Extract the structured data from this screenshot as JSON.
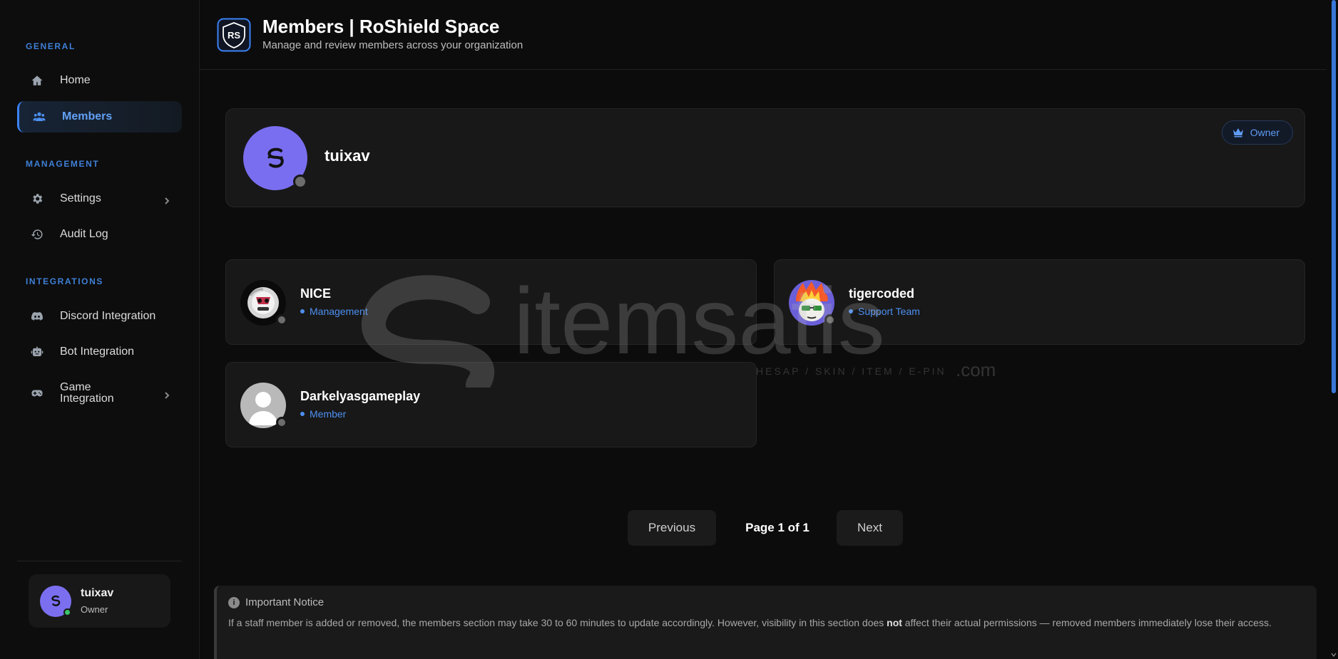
{
  "sidebar": {
    "sections": {
      "general": "GENERAL",
      "management": "MANAGEMENT",
      "integrations": "INTEGRATIONS"
    },
    "items": {
      "home": {
        "label": "Home",
        "icon": "home-icon"
      },
      "members": {
        "label": "Members",
        "icon": "users-icon",
        "active": true
      },
      "settings": {
        "label": "Settings",
        "icon": "gear-icon"
      },
      "audit_log": {
        "label": "Audit Log",
        "icon": "history-icon"
      },
      "discord": {
        "label": "Discord Integration",
        "icon": "discord-icon"
      },
      "bot": {
        "label": "Bot Integration",
        "icon": "robot-icon"
      },
      "game_line1": "Game",
      "game_line2": "Integration"
    },
    "user": {
      "name": "tuixav",
      "role": "Owner",
      "status": "online"
    }
  },
  "header": {
    "logo_text": "RS",
    "title": "Members | RoShield Space",
    "subtitle": "Manage and review members across your organization"
  },
  "owner": {
    "name": "tuixav",
    "badge": "Owner",
    "status": "offline"
  },
  "members": [
    {
      "name": "NICE",
      "role": "Management",
      "status": "offline"
    },
    {
      "name": "tigercoded",
      "role": "Support Team",
      "status": "offline"
    },
    {
      "name": "Darkelyasgameplay",
      "role": "Member",
      "status": "offline"
    }
  ],
  "pagination": {
    "previous": "Previous",
    "page_text": "Page 1 of 1",
    "next": "Next"
  },
  "notice": {
    "title": "Important Notice",
    "body_before": "If a staff member is added or removed, the members section may take 30 to 60 minutes to update accordingly. However, visibility in this section does ",
    "body_bold": "not",
    "body_after": " affect their actual permissions — removed members immediately lose their access."
  },
  "watermark": {
    "brand": "itemsatis",
    "tagline": "HESAP / SKIN / ITEM / E-PIN",
    "suffix": ".com"
  },
  "colors": {
    "accent": "#3b82f6",
    "avatar": "#7a6ef0",
    "online": "#3bc46a",
    "offline": "#6d6d6d",
    "background": "#0c0c0c"
  }
}
